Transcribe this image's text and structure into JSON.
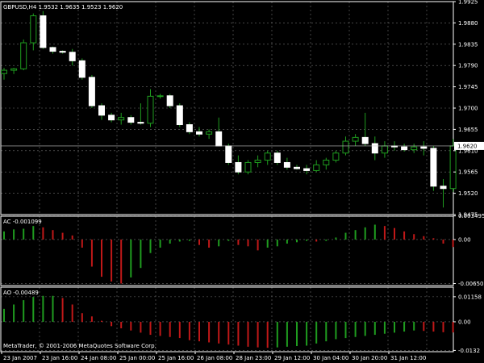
{
  "header": {
    "main_label": "GBPUSD,H4  1.9532 1.9635 1.9523 1.9620",
    "ac_label": "AC -0.001099",
    "ao_label": "AO -0.00489",
    "copyright": "MetaTrader, © 2001-2006 MetaQuotes Software Corp."
  },
  "colors": {
    "background": "#000000",
    "grid": "#707070",
    "candle": "#ffffff",
    "bull_bar": "#1f9c1f",
    "bear_bar": "#c01818",
    "price_tag_bg": "#ffffff",
    "price_tag_text": "#000000"
  },
  "chart_data": [
    {
      "type": "candlestick",
      "symbol": "GBPUSD",
      "timeframe": "H4",
      "ylim": [
        1.9475,
        1.9925
      ],
      "y_ticks": [
        "1.9925",
        "1.9880",
        "1.9835",
        "1.9790",
        "1.9745",
        "1.9700",
        "1.9655",
        "1.9610",
        "1.9565",
        "1.9520",
        "1.9475"
      ],
      "current_price": "1.9620",
      "ohlc": [
        [
          1.9773,
          1.9785,
          1.976,
          1.978
        ],
        [
          1.978,
          1.9785,
          1.9772,
          1.9783
        ],
        [
          1.9783,
          1.9845,
          1.978,
          1.9838
        ],
        [
          1.9838,
          1.99,
          1.9822,
          1.9895
        ],
        [
          1.9895,
          1.9905,
          1.9825,
          1.9828
        ],
        [
          1.9828,
          1.983,
          1.9815,
          1.982
        ],
        [
          1.982,
          1.9822,
          1.9815,
          1.9818
        ],
        [
          1.9818,
          1.9825,
          1.979,
          1.98
        ],
        [
          1.98,
          1.9805,
          1.976,
          1.9765
        ],
        [
          1.9765,
          1.977,
          1.97,
          1.9705
        ],
        [
          1.9705,
          1.971,
          1.9675,
          1.9685
        ],
        [
          1.9685,
          1.969,
          1.967,
          1.9675
        ],
        [
          1.9675,
          1.969,
          1.9665,
          1.968
        ],
        [
          1.968,
          1.9685,
          1.9665,
          1.967
        ],
        [
          1.967,
          1.971,
          1.9665,
          1.9668
        ],
        [
          1.9668,
          1.974,
          1.966,
          1.9725
        ],
        [
          1.9725,
          1.973,
          1.972,
          1.9726
        ],
        [
          1.9726,
          1.973,
          1.97,
          1.9705
        ],
        [
          1.9705,
          1.971,
          1.966,
          1.9665
        ],
        [
          1.9665,
          1.967,
          1.9645,
          1.965
        ],
        [
          1.965,
          1.966,
          1.964,
          1.9645
        ],
        [
          1.9645,
          1.9655,
          1.9635,
          1.965
        ],
        [
          1.965,
          1.968,
          1.963,
          1.962
        ],
        [
          1.962,
          1.9625,
          1.958,
          1.9585
        ],
        [
          1.9585,
          1.96,
          1.956,
          1.9565
        ],
        [
          1.9565,
          1.959,
          1.956,
          1.9585
        ],
        [
          1.9585,
          1.96,
          1.9575,
          1.959
        ],
        [
          1.959,
          1.961,
          1.958,
          1.9605
        ],
        [
          1.9605,
          1.961,
          1.958,
          1.9585
        ],
        [
          1.9585,
          1.9595,
          1.957,
          1.9575
        ],
        [
          1.9575,
          1.958,
          1.957,
          1.9572
        ],
        [
          1.9572,
          1.958,
          1.956,
          1.9568
        ],
        [
          1.9568,
          1.959,
          1.9565,
          1.958
        ],
        [
          1.958,
          1.9595,
          1.957,
          1.959
        ],
        [
          1.959,
          1.961,
          1.9585,
          1.9605
        ],
        [
          1.9605,
          1.964,
          1.96,
          1.963
        ],
        [
          1.963,
          1.9645,
          1.962,
          1.9638
        ],
        [
          1.9638,
          1.969,
          1.962,
          1.9625
        ],
        [
          1.9625,
          1.964,
          1.959,
          1.9605
        ],
        [
          1.9605,
          1.963,
          1.9595,
          1.962
        ],
        [
          1.962,
          1.963,
          1.961,
          1.9618
        ],
        [
          1.9618,
          1.9625,
          1.9608,
          1.9612
        ],
        [
          1.9612,
          1.9625,
          1.9605,
          1.9618
        ],
        [
          1.9618,
          1.963,
          1.96,
          1.9615
        ],
        [
          1.9615,
          1.962,
          1.9525,
          1.9535
        ],
        [
          1.9535,
          1.955,
          1.949,
          1.953
        ],
        [
          1.953,
          1.9635,
          1.9523,
          1.962
        ]
      ]
    },
    {
      "type": "bar",
      "title": "AC",
      "value_label": "-0.001099",
      "ylim": [
        -0.0068,
        0.00345
      ],
      "y_ticks": [
        "0.003495",
        "0.00",
        "-0.00650"
      ],
      "values": [
        0.0012,
        0.0015,
        0.0016,
        0.002,
        0.0018,
        0.0014,
        0.001,
        0.0006,
        -0.0012,
        -0.004,
        -0.0055,
        -0.0062,
        -0.0065,
        -0.0056,
        -0.0042,
        -0.002,
        -0.0012,
        -0.0006,
        -0.0003,
        -0.0002,
        -0.0008,
        -0.0012,
        -0.001,
        -0.0002,
        -0.0008,
        -0.001,
        -0.0016,
        -0.0012,
        -0.001,
        -0.0006,
        -0.0004,
        -0.0002,
        -0.0003,
        -0.0002,
        0.0003,
        0.001,
        0.0014,
        0.0018,
        0.0022,
        0.002,
        0.0017,
        0.0012,
        0.0008,
        0.0005,
        0.0002,
        -0.0006,
        -0.0011
      ]
    },
    {
      "type": "bar",
      "title": "AO",
      "value_label": "-0.00489",
      "ylim": [
        -0.0138,
        0.016
      ],
      "y_ticks": [
        "0.01158",
        "0.00",
        "-0.0132"
      ],
      "values": [
        0.006,
        0.008,
        0.01,
        0.0115,
        0.012,
        0.012,
        0.011,
        0.008,
        0.004,
        0.0025,
        0.0005,
        -0.002,
        -0.003,
        -0.004,
        -0.005,
        -0.006,
        -0.0065,
        -0.007,
        -0.0075,
        -0.0085,
        -0.009,
        -0.0095,
        -0.01,
        -0.0105,
        -0.011,
        -0.0115,
        -0.0118,
        -0.012,
        -0.0118,
        -0.0115,
        -0.0112,
        -0.011,
        -0.01,
        -0.009,
        -0.008,
        -0.0075,
        -0.007,
        -0.0065,
        -0.006,
        -0.0055,
        -0.005,
        -0.0045,
        -0.004,
        -0.0042,
        -0.0045,
        -0.0048,
        -0.0049
      ]
    }
  ],
  "x_axis": {
    "labels": [
      "23 Jan 2007",
      "23 Jan 16:00",
      "24 Jan 08:00",
      "25 Jan 00:00",
      "25 Jan 16:00",
      "26 Jan 08:00",
      "28 Jan 23:00",
      "29 Jan 12:00",
      "30 Jan 04:00",
      "30 Jan 20:00",
      "31 Jan 12:00"
    ]
  }
}
